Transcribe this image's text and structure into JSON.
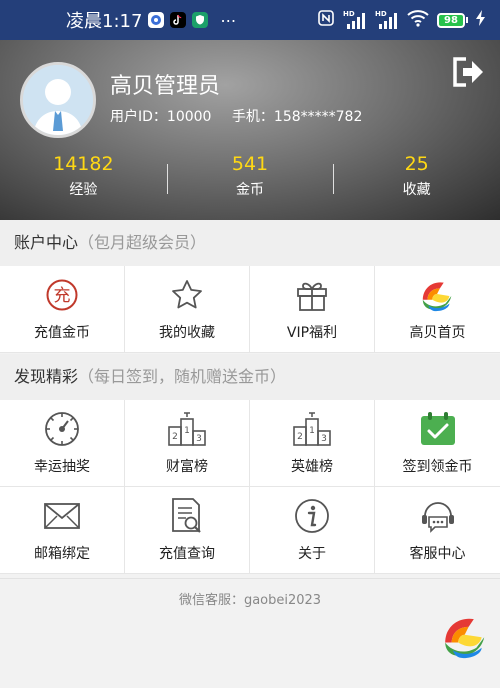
{
  "status_bar": {
    "time": "凌晨1:17",
    "dots": "⋯",
    "signal_1": "HD",
    "signal_2": "HD",
    "battery": "98"
  },
  "profile": {
    "name": "高贝管理员",
    "user_id": "用户ID：10000",
    "phone": "手机：158*****782"
  },
  "stats": [
    {
      "value": "14182",
      "label": "经验"
    },
    {
      "value": "541",
      "label": "金币"
    },
    {
      "value": "25",
      "label": "收藏"
    }
  ],
  "account": {
    "title": "账户中心",
    "subtitle": "（包月超级会员）",
    "items": [
      {
        "label": "充值金币",
        "icon": "recharge-icon"
      },
      {
        "label": "我的收藏",
        "icon": "star-icon"
      },
      {
        "label": "VIP福利",
        "icon": "gift-icon"
      },
      {
        "label": "高贝首页",
        "icon": "gaobei-logo-icon"
      }
    ]
  },
  "discover": {
    "title": "发现精彩",
    "subtitle": "（每日签到，随机赠送金币）",
    "items": [
      {
        "label": "幸运抽奖",
        "icon": "lottery-wheel-icon"
      },
      {
        "label": "财富榜",
        "icon": "podium-icon"
      },
      {
        "label": "英雄榜",
        "icon": "podium-icon"
      },
      {
        "label": "签到领金币",
        "icon": "calendar-check-icon"
      },
      {
        "label": "邮箱绑定",
        "icon": "mail-icon"
      },
      {
        "label": "充值查询",
        "icon": "search-document-icon"
      },
      {
        "label": "关于",
        "icon": "info-icon"
      },
      {
        "label": "客服中心",
        "icon": "headset-chat-icon"
      }
    ]
  },
  "footer": {
    "text": "微信客服：gaobei2023"
  },
  "podium": {
    "a": "2",
    "b": "1",
    "c": "3"
  },
  "recharge_char": "充",
  "colors": {
    "status_bar": "#243f7a",
    "stat_value": "#ffd814",
    "recharge_red": "#c0392b",
    "calendar_green": "#4caf50"
  }
}
